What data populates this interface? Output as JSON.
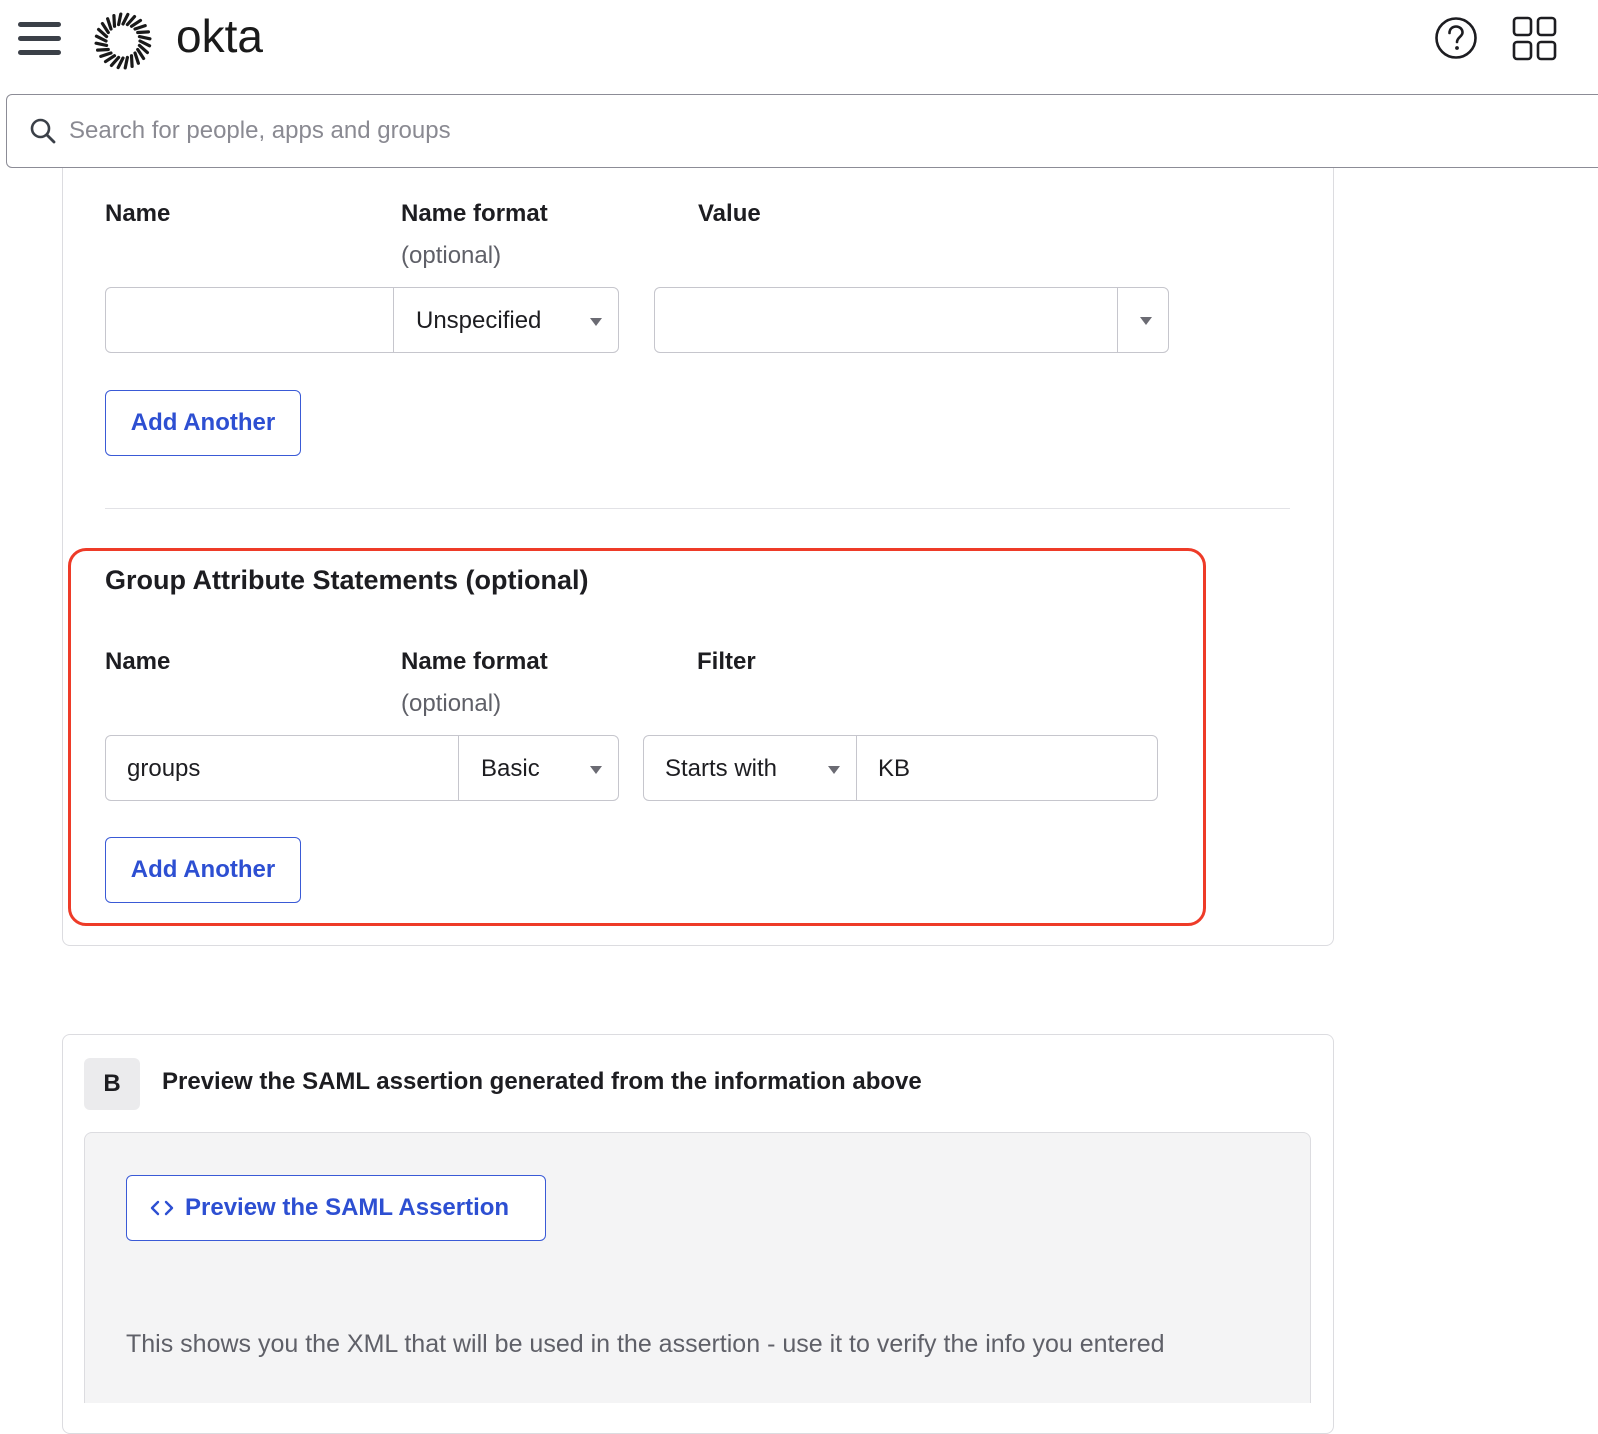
{
  "header": {
    "brand": "okta",
    "menu_icon": "hamburger-menu-icon",
    "logo_icon": "okta-sunburst-logo-icon",
    "help_icon": "help-circle-icon",
    "apps_icon": "app-grid-icon"
  },
  "search": {
    "placeholder": "Search for people, apps and groups",
    "value": "",
    "icon": "search-icon"
  },
  "attribute_statements": {
    "columns": {
      "name": "Name",
      "name_format": "Name format",
      "name_format_optional": "(optional)",
      "value": "Value"
    },
    "row": {
      "name": "",
      "name_format": "Unspecified",
      "value": ""
    },
    "add_another": "Add Another"
  },
  "group_attribute_statements": {
    "title": "Group Attribute Statements (optional)",
    "columns": {
      "name": "Name",
      "name_format": "Name format",
      "name_format_optional": "(optional)",
      "filter": "Filter"
    },
    "row": {
      "name": "groups",
      "name_format": "Basic",
      "filter_type": "Starts with",
      "filter_value": "KB"
    },
    "add_another": "Add Another",
    "highlight_color": "#ee3b28"
  },
  "preview_section": {
    "step": "B",
    "title": "Preview the SAML assertion generated from the information above",
    "button_label": "Preview the SAML Assertion",
    "button_icon": "code-brackets-icon",
    "helper_text": "This shows you the XML that will be used in the assertion - use it to verify the info you entered"
  },
  "colors": {
    "accent": "#2d4fd2",
    "text": "#1d1d21",
    "muted": "#5f6068",
    "border": "#c6c6cd",
    "panel": "#f4f4f5"
  }
}
